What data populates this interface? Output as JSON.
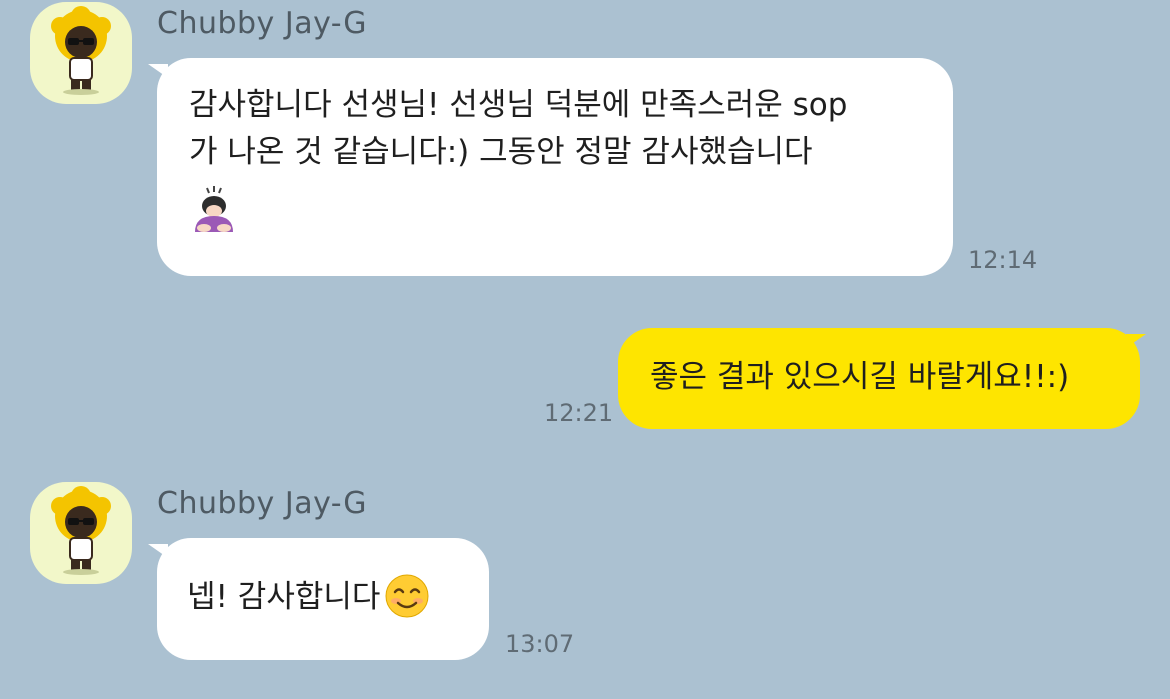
{
  "messages": [
    {
      "sender": "Chubby Jay-G",
      "line1": "감사합니다 선생님! 선생님 덕분에 만족스러운 sop",
      "line2": "가 나온 것 같습니다:) 그동안 정말 감사했습니다",
      "emoji": "person-bowing-emoji",
      "time": "12:14"
    },
    {
      "sender": "me",
      "text": "좋은 결과 있으시길 바랄게요!!:)",
      "time": "12:21"
    },
    {
      "sender": "Chubby Jay-G",
      "text": "넵! 감사합니다",
      "emoji": "smiling-face-emoji",
      "time": "13:07"
    }
  ],
  "colors": {
    "background": "#abc1d1",
    "incoming_bubble": "#ffffff",
    "outgoing_bubble": "#fee500",
    "avatar_bg": "#f2f7c9"
  }
}
